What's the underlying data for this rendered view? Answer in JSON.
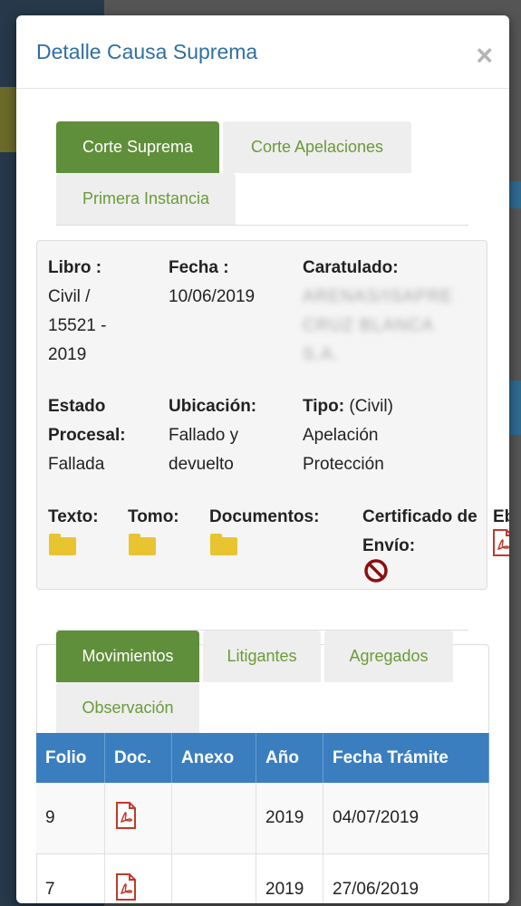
{
  "modal": {
    "title": "Detalle Causa Suprema",
    "close_label": "×"
  },
  "court_tabs": [
    {
      "label": "Corte Suprema",
      "active": true
    },
    {
      "label": "Corte Apelaciones",
      "active": false
    },
    {
      "label": "Primera Instancia",
      "active": false
    }
  ],
  "case": {
    "libro_label": "Libro :",
    "libro_value": "Civil / 15521 - 2019",
    "fecha_label": "Fecha :",
    "fecha_value": "10/06/2019",
    "caratulado_label": "Caratulado:",
    "caratulado_value": "ARENAS/ISAPRE CRUZ BLANCA S.A.",
    "estado_label": "Estado Procesal:",
    "estado_value": "Fallada",
    "ubicacion_label": "Ubicación:",
    "ubicacion_value": "Fallado y devuelto",
    "tipo_label": "Tipo:",
    "tipo_value": "(Civil) Apelación Protección",
    "texto_label": "Texto:",
    "tomo_label": "Tomo:",
    "documentos_label": "Documentos:",
    "certificado_label": "Certificado de Envío:",
    "extra_label": "Eb"
  },
  "detail_tabs": [
    {
      "label": "Movimientos",
      "active": true
    },
    {
      "label": "Litigantes",
      "active": false
    },
    {
      "label": "Agregados",
      "active": false
    },
    {
      "label": "Observación",
      "active": false
    }
  ],
  "table": {
    "headers": [
      "Folio",
      "Doc.",
      "Anexo",
      "Año",
      "Fecha Trámite"
    ],
    "rows": [
      {
        "folio": "9",
        "anexo": "",
        "anio": "2019",
        "fecha": "04/07/2019"
      },
      {
        "folio": "7",
        "anexo": "",
        "anio": "2019",
        "fecha": "27/06/2019"
      }
    ]
  },
  "colors": {
    "accent_green": "#5f8f3a",
    "title_blue": "#2f6fa3",
    "table_header_blue": "#3a7ebf",
    "folder_yellow": "#e8c430",
    "pdf_red": "#c0392b"
  }
}
